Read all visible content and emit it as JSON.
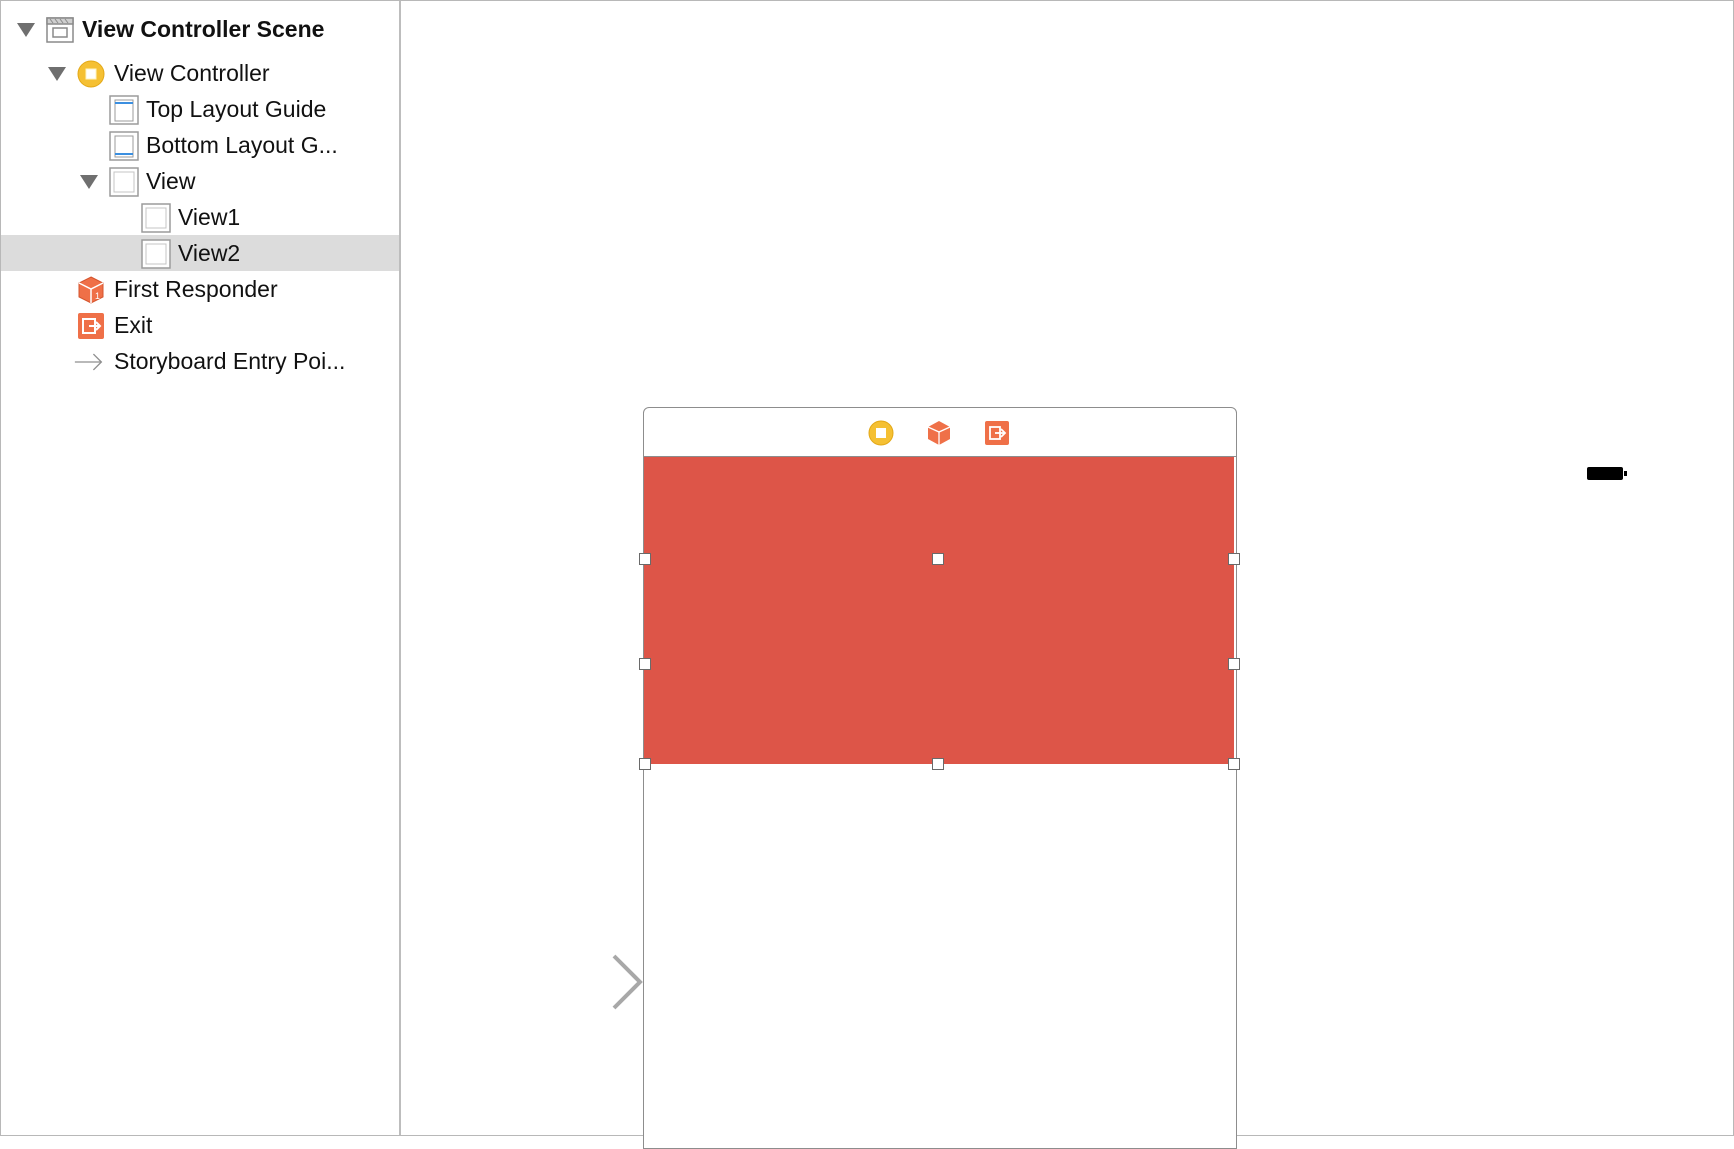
{
  "outline": {
    "items": [
      {
        "label": "View Controller Scene",
        "icon": "scene-icon"
      },
      {
        "label": "View Controller",
        "icon": "view-controller-icon"
      },
      {
        "label": "Top Layout Guide",
        "icon": "top-layout-guide-icon"
      },
      {
        "label": "Bottom Layout G...",
        "icon": "bottom-layout-guide-icon"
      },
      {
        "label": "View",
        "icon": "view-icon"
      },
      {
        "label": "View1",
        "icon": "view-icon"
      },
      {
        "label": "View2",
        "icon": "view-icon"
      },
      {
        "label": "First Responder",
        "icon": "first-responder-icon"
      },
      {
        "label": "Exit",
        "icon": "exit-icon"
      },
      {
        "label": "Storyboard Entry Poi...",
        "icon": "entry-point-arrow-icon"
      }
    ],
    "selected": "View2"
  },
  "canvas": {
    "dock_icons": [
      "view-controller-icon",
      "first-responder-icon",
      "exit-icon"
    ],
    "selected_view_color": "#dd5548",
    "status_bar": {
      "icon": "battery-icon"
    },
    "entry_point": "entry-point-arrow-icon"
  },
  "colors": {
    "view_controller": "#f5c033",
    "first_responder": "#ef7048",
    "exit": "#ef7048",
    "selection_row": "#dcdcdc",
    "selected_view": "#dd5548"
  }
}
